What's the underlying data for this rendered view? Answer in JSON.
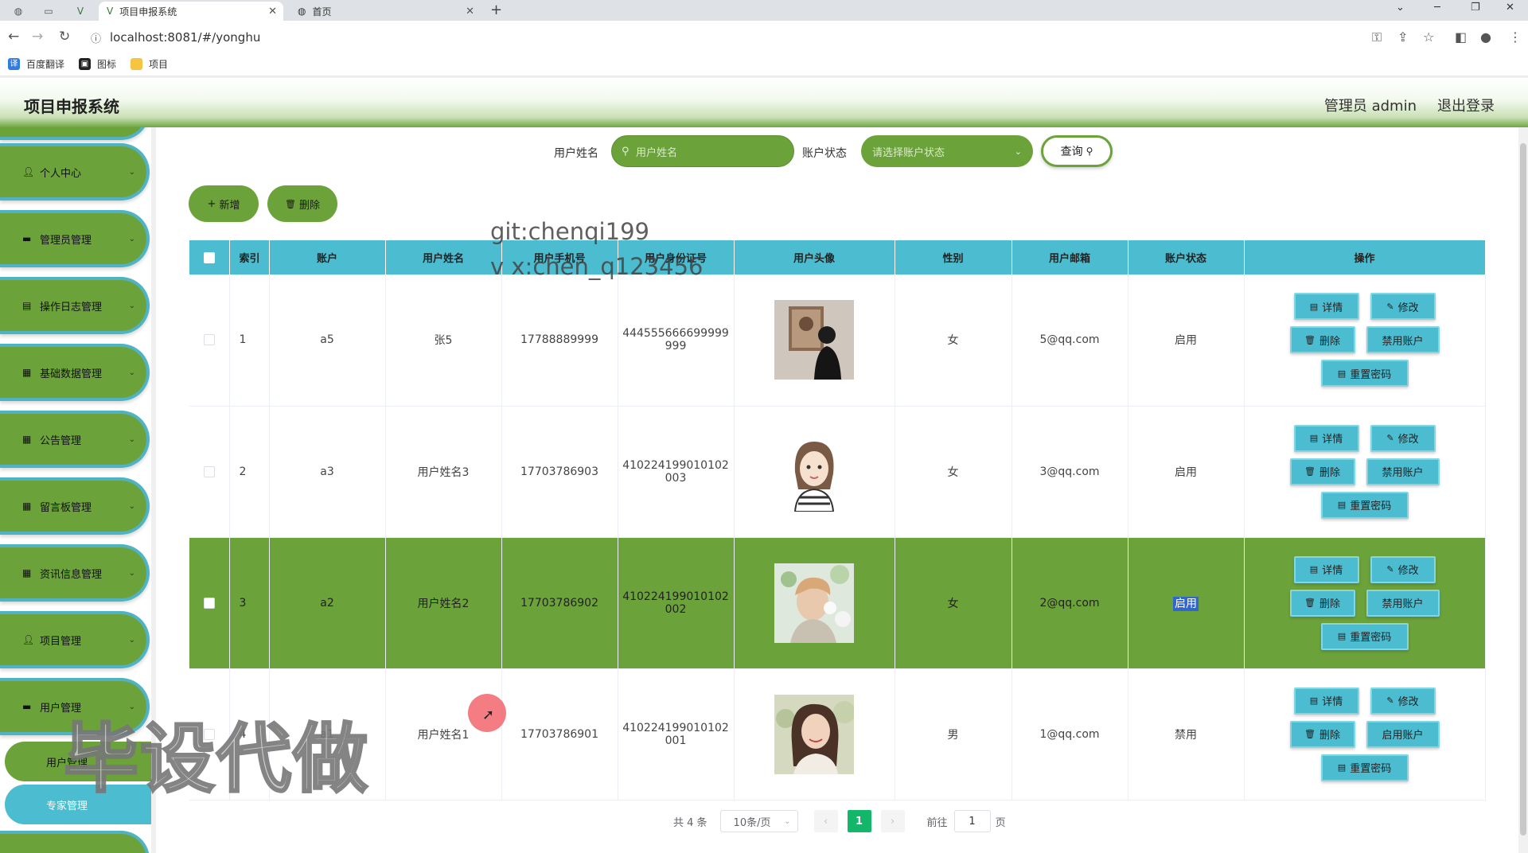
{
  "browser": {
    "tabs": [
      {
        "label": "项目申报系统",
        "active": true
      },
      {
        "label": "首页",
        "active": false
      }
    ],
    "url": "localhost:8081/#/yonghu",
    "bookmarks": [
      "百度翻译",
      "图标",
      "项目"
    ]
  },
  "header": {
    "title": "项目申报系统",
    "admin": "管理员 admin",
    "logout": "退出登录"
  },
  "sidebar": {
    "items": [
      {
        "label": "个人中心",
        "icon": "user-icon"
      },
      {
        "label": "管理员管理",
        "icon": "monitor-icon"
      },
      {
        "label": "操作日志管理",
        "icon": "doc-icon"
      },
      {
        "label": "基础数据管理",
        "icon": "grid-icon"
      },
      {
        "label": "公告管理",
        "icon": "grid-icon"
      },
      {
        "label": "留言板管理",
        "icon": "grid-icon"
      },
      {
        "label": "资讯信息管理",
        "icon": "grid-icon"
      },
      {
        "label": "项目管理",
        "icon": "user-icon"
      },
      {
        "label": "用户管理",
        "icon": "monitor-icon"
      }
    ],
    "subitems": [
      {
        "label": "用户管理",
        "active": true
      },
      {
        "label": "专家管理",
        "active": false
      }
    ]
  },
  "search": {
    "name_label": "用户姓名",
    "name_placeholder": "用户姓名",
    "status_label": "账户状态",
    "status_placeholder": "请选择账户状态",
    "query_button": "查询"
  },
  "actions": {
    "add": "新增",
    "delete": "删除"
  },
  "watermark": {
    "line1": "git:chenqi199",
    "line2": "v x:chen_q123456",
    "big": "毕设代做"
  },
  "table": {
    "columns": [
      "索引",
      "账户",
      "用户姓名",
      "用户手机号",
      "用户身份证号",
      "用户头像",
      "性别",
      "用户邮箱",
      "账户状态",
      "操作"
    ],
    "rows": [
      {
        "index": "1",
        "account": "a5",
        "name": "张5",
        "phone": "17788889999",
        "id_line1": "444555666699999",
        "id_line2": "999",
        "avatar": "photo-man-wall",
        "gender": "女",
        "email": "5@qq.com",
        "status": "启用",
        "toggle": "禁用账户",
        "highlight": false
      },
      {
        "index": "2",
        "account": "a3",
        "name": "用户姓名3",
        "phone": "17703786903",
        "id_line1": "410224199010102",
        "id_line2": "003",
        "avatar": "cartoon-girl",
        "gender": "女",
        "email": "3@qq.com",
        "status": "启用",
        "toggle": "禁用账户",
        "highlight": false
      },
      {
        "index": "3",
        "account": "a2",
        "name": "用户姓名2",
        "phone": "17703786902",
        "id_line1": "410224199010102",
        "id_line2": "002",
        "avatar": "photo-man-flowers",
        "gender": "女",
        "email": "2@qq.com",
        "status": "启用",
        "toggle": "禁用账户",
        "highlight": true
      },
      {
        "index": "4",
        "account": "a1",
        "name": "用户姓名1",
        "phone": "17703786901",
        "id_line1": "410224199010102",
        "id_line2": "001",
        "avatar": "photo-woman",
        "gender": "男",
        "email": "1@qq.com",
        "status": "禁用",
        "toggle": "启用账户",
        "highlight": false
      }
    ],
    "op_labels": {
      "detail": "详情",
      "edit": "修改",
      "delete": "删除",
      "reset": "重置密码"
    }
  },
  "pagination": {
    "total": "共 4 条",
    "page_size": "10条/页",
    "current": "1",
    "goto_label": "前往",
    "goto_value": "1",
    "page_suffix": "页"
  },
  "colors": {
    "green": "#6ca23a",
    "cyan": "#4cbcd0",
    "page_active": "#12b76a"
  }
}
